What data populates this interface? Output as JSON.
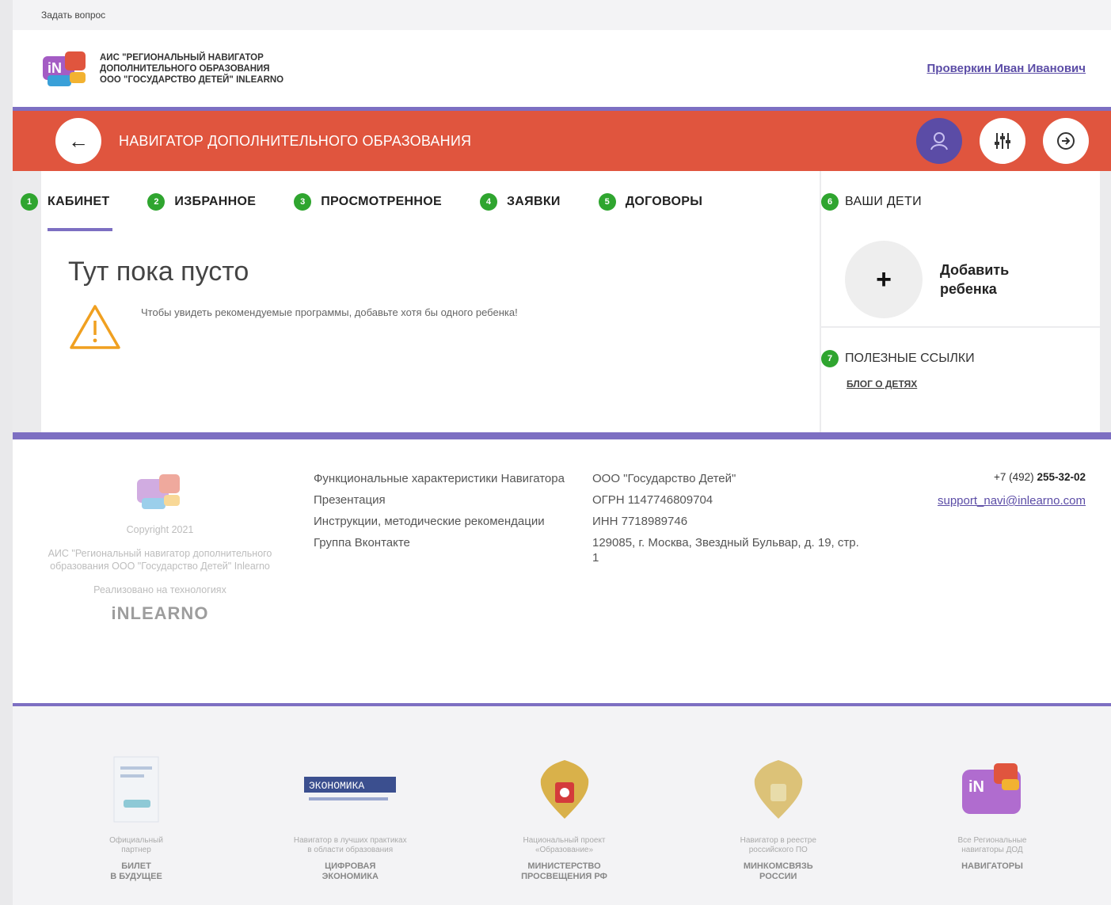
{
  "topline": {
    "ask_link": "Задать вопрос"
  },
  "header": {
    "brand_lines": [
      "АИС \"РЕГИОНАЛЬНЫЙ НАВИГАТОР",
      "ДОПОЛНИТЕЛЬНОГО ОБРАЗОВАНИЯ",
      "ООО \"ГОСУДАРСТВО ДЕТЕЙ\" INLEARNO"
    ],
    "user_name": "Проверкин Иван Иванович"
  },
  "navbar": {
    "title": "НАВИГАТОР ДОПОЛНИТЕЛЬНОГО ОБРАЗОВАНИЯ",
    "colors": {
      "bar": "#e0553e",
      "accent": "#7d6fc2"
    }
  },
  "tabs": [
    {
      "num": "1",
      "label": "КАБИНЕТ"
    },
    {
      "num": "2",
      "label": "ИЗБРАННОЕ"
    },
    {
      "num": "3",
      "label": "ПРОСМОТРЕННОЕ"
    },
    {
      "num": "4",
      "label": "ЗАЯВКИ"
    },
    {
      "num": "5",
      "label": "ДОГОВОРЫ"
    }
  ],
  "side": {
    "num": "6",
    "label": "ВАШИ ДЕТИ",
    "add_label": "Добавить ребенка",
    "add_symbol": "+",
    "links_num": "7",
    "links_title": "ПОЛЕЗНЫЕ ССЫЛКИ",
    "blog_link": "БЛОГ О ДЕТЯХ"
  },
  "main": {
    "empty_title": "Тут пока пусто",
    "warning_text": "Чтобы увидеть рекомендуемые программы, добавьте хотя бы одного ребенка!"
  },
  "footer": {
    "copyright": "Copyright 2021",
    "org": "АИС \"Региональный навигатор дополнительного образования ООО \"Государство Детей\" Inlearno",
    "realized": "Реализовано на технологиях",
    "inlearno": "iNLEARNO",
    "links": [
      "Функциональные характеристики Навигатора",
      "Презентация",
      "Инструкции, методические рекомендации",
      "Группа Вконтакте"
    ],
    "company": [
      "ООО \"Государство Детей\"",
      "ОГРН 1147746809704",
      "ИНН 7718989746",
      "129085, г. Москва, Звездный Бульвар, д. 19, стр. 1"
    ],
    "phone_prefix": "+7 (492) ",
    "phone_main": "255-32-02",
    "email": "support_navi@inlearno.com"
  },
  "partners": [
    {
      "caption": "Официальный\nпартнер",
      "name": "БИЛЕТ\nВ БУДУЩЕЕ"
    },
    {
      "caption": "Навигатор в лучших практиках\nв области образования",
      "name": "ЦИФРОВАЯ\nЭКОНОМИКА",
      "logo_text": "ЭКОНОМИКА"
    },
    {
      "caption": "Национальный проект\n«Образование»",
      "name": "МИНИСТЕРСТВО\nПРОСВЕЩЕНИЯ РФ"
    },
    {
      "caption": "Навигатор в реестре\nроссийского ПО",
      "name": "МИНКОМСВЯЗЬ\nРОССИИ"
    },
    {
      "caption": "Все Региональные\nнавигаторы ДОД",
      "name": "НАВИГАТОРЫ"
    }
  ]
}
